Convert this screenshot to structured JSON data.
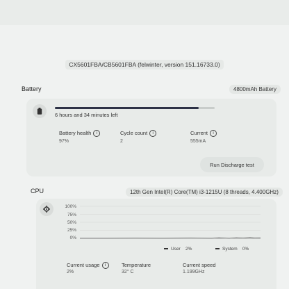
{
  "device": "CX5601FBA/CB5601FBA  (felwinter, version 151.16733.0)",
  "battery": {
    "title": "Battery",
    "capacity_badge": "4800mAh Battery",
    "time_left": "6 hours and 34 minutes left",
    "charge_fraction": 0.9,
    "stats": [
      {
        "label": "Battery health",
        "value": "97%"
      },
      {
        "label": "Cycle count",
        "value": "2"
      },
      {
        "label": "Current",
        "value": "555mA"
      }
    ],
    "discharge_button": "Run Discharge test"
  },
  "cpu": {
    "title": "CPU",
    "model_badge": "12th Gen Intel(R) Core(TM) i3-1215U (8 threads, 4.400GHz)",
    "y_ticks": [
      "100%",
      "75%",
      "50%",
      "25%",
      "0%"
    ],
    "legend": [
      {
        "label": "User",
        "value": "2%"
      },
      {
        "label": "System",
        "value": "0%"
      }
    ],
    "stats": [
      {
        "label": "Current usage",
        "value": "2%"
      },
      {
        "label": "Temperature",
        "value": "32° C"
      },
      {
        "label": "Current speed",
        "value": "1.199GHz"
      }
    ]
  }
}
